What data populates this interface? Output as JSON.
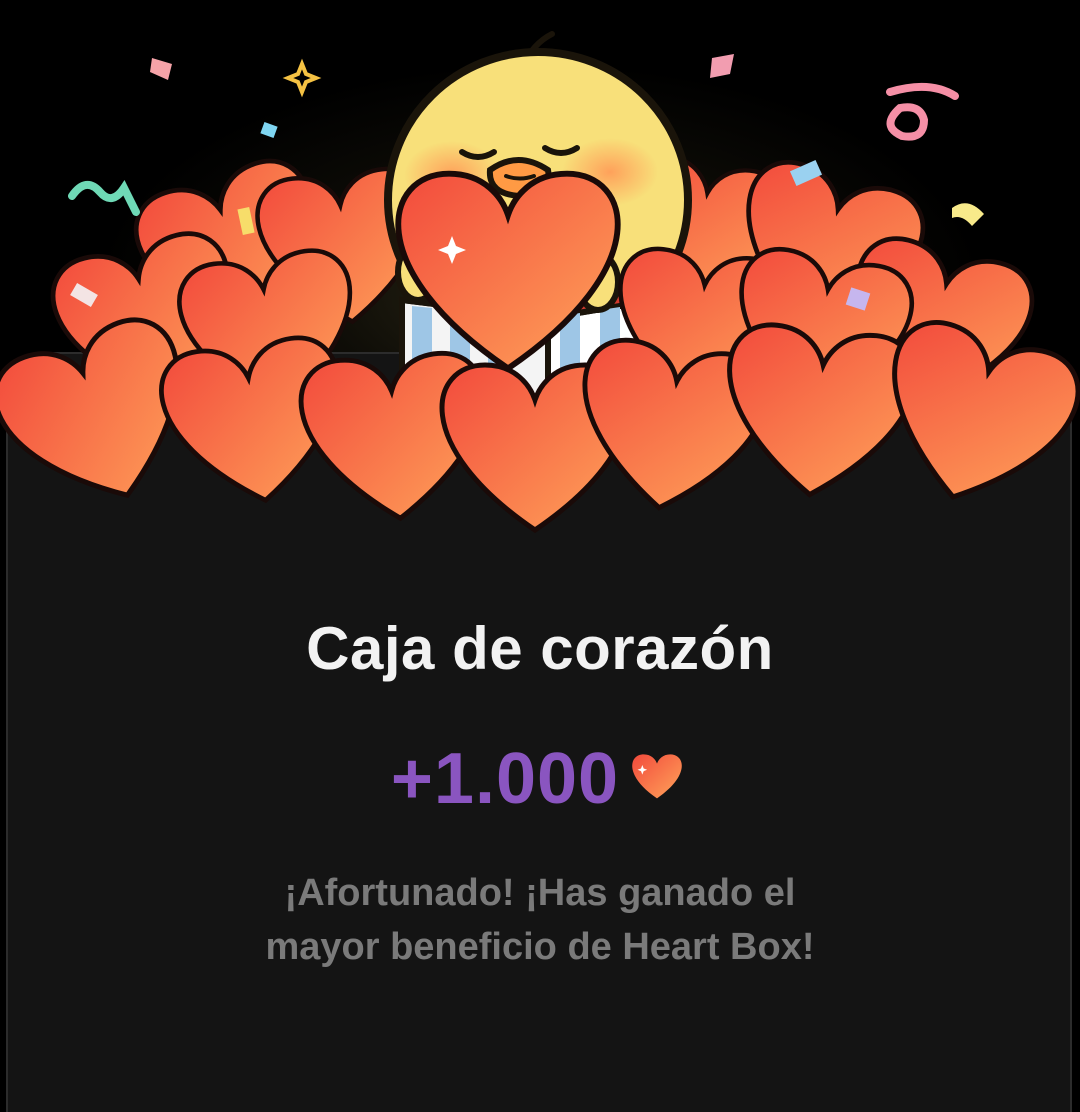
{
  "dialog": {
    "title": "Caja de corazón",
    "reward": {
      "amount": "+1.000",
      "currency_icon": "heart-icon"
    },
    "message_lines": [
      "¡Afortunado! ¡Has ganado el",
      "mayor beneficio de Heart Box!"
    ]
  },
  "illustration": {
    "character_icon": "chick-mascot",
    "items": [
      "gift-box",
      "heart-pile",
      "confetti"
    ]
  },
  "colors": {
    "background": "#000000",
    "card": "#141414",
    "title": "#f2f2f2",
    "amount": "#8a55c0",
    "message": "#7a7a7a",
    "heart_light": "#ff9a57",
    "heart_dark": "#f24a3c"
  }
}
